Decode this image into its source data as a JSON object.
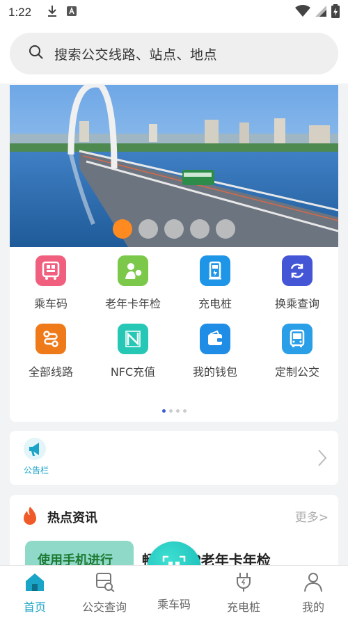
{
  "status_bar": {
    "time": "1:22"
  },
  "search": {
    "placeholder": "搜索公交线路、站点、地点"
  },
  "banner": {
    "slide_count": 5,
    "active_index": 0
  },
  "shortcuts": [
    {
      "label": "乘车码",
      "icon": "bus-qr-code-icon",
      "color": "#f0607e"
    },
    {
      "label": "老年卡年检",
      "icon": "elderly-card-icon",
      "color": "#7cc84a"
    },
    {
      "label": "充电桩",
      "icon": "charging-pile-icon",
      "color": "#1f95e8"
    },
    {
      "label": "换乘查询",
      "icon": "transfer-query-icon",
      "color": "#4456d6"
    },
    {
      "label": "全部线路",
      "icon": "all-routes-icon",
      "color": "#ee7a1a"
    },
    {
      "label": "NFC充值",
      "icon": "nfc-icon",
      "color": "#27c7b6"
    },
    {
      "label": "我的钱包",
      "icon": "wallet-icon",
      "color": "#1f8ce6"
    },
    {
      "label": "定制公交",
      "icon": "custom-bus-icon",
      "color": "#2a9fe8"
    }
  ],
  "shortcut_pages": {
    "count": 4,
    "active_index": 0
  },
  "notice": {
    "label": "公告栏"
  },
  "news": {
    "title": "热点资讯",
    "more": "更多>",
    "thumb_text": "使用手机进行",
    "headline": "畅州APP老年卡年检"
  },
  "tabs": [
    {
      "label": "首页",
      "icon": "home-icon",
      "active": true
    },
    {
      "label": "公交查询",
      "icon": "bus-search-icon",
      "active": false
    },
    {
      "label": "乘车码",
      "icon": "qr-code-icon",
      "active": false
    },
    {
      "label": "充电桩",
      "icon": "charging-plug-icon",
      "active": false
    },
    {
      "label": "我的",
      "icon": "person-icon",
      "active": false
    }
  ],
  "colors": {
    "accent": "#1aa4c7",
    "banner_dot_active": "#ff8a1f"
  }
}
